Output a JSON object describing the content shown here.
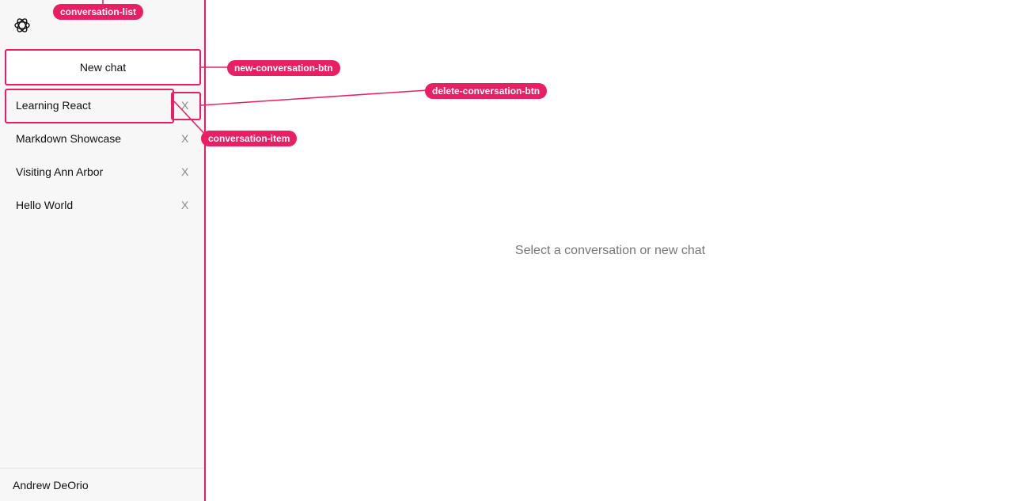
{
  "sidebar": {
    "new_chat_label": "New chat",
    "conversations": [
      {
        "title": "Learning React",
        "delete_label": "X"
      },
      {
        "title": "Markdown Showcase",
        "delete_label": "X"
      },
      {
        "title": "Visiting Ann Arbor",
        "delete_label": "X"
      },
      {
        "title": "Hello World",
        "delete_label": "X"
      }
    ],
    "user_name": "Andrew DeOrio"
  },
  "main": {
    "empty_state": "Select a conversation or new chat"
  },
  "annotations": {
    "conversation_list": "conversation-list",
    "new_conversation_btn": "new-conversation-btn",
    "delete_conversation_btn": "delete-conversation-btn",
    "conversation_item": "conversation-item"
  },
  "colors": {
    "annotation": "#e91e63",
    "sidebar_bg": "#f7f7f7"
  }
}
